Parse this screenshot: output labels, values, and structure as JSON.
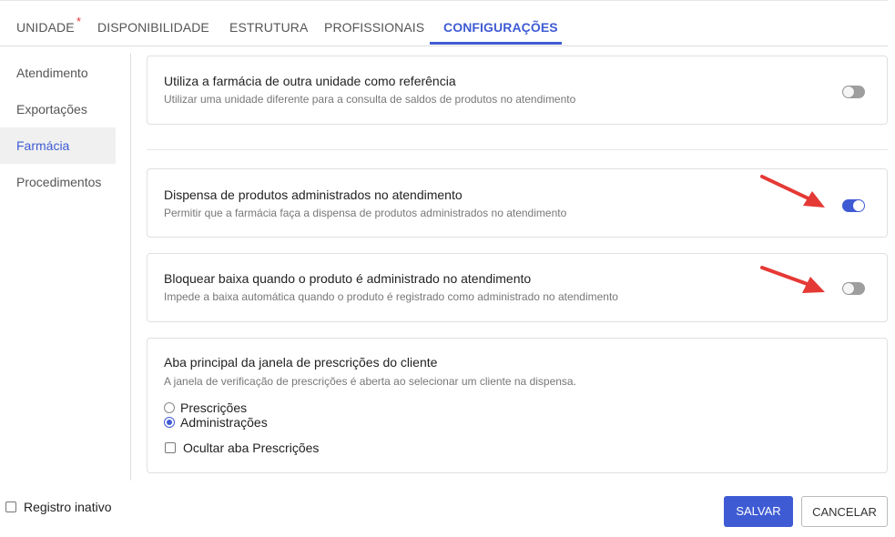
{
  "tabs": [
    {
      "label": "UNIDADE",
      "required_mark": "*"
    },
    {
      "label": "DISPONIBILIDADE"
    },
    {
      "label": "ESTRUTURA"
    },
    {
      "label": "PROFISSIONAIS"
    },
    {
      "label": "CONFIGURAÇÕES",
      "active": true
    }
  ],
  "sidebar": {
    "items": [
      {
        "label": "Atendimento"
      },
      {
        "label": "Exportações"
      },
      {
        "label": "Farmácia",
        "active": true
      },
      {
        "label": "Procedimentos"
      }
    ]
  },
  "settings": [
    {
      "title": "Utiliza a farmácia de outra unidade como referência",
      "description": "Utilizar uma unidade diferente para a consulta de saldos de produtos no atendimento",
      "enabled": false
    },
    {
      "title": "Dispensa de produtos administrados no atendimento",
      "description": "Permitir que a farmácia faça a dispensa de produtos administrados no atendimento",
      "enabled": true
    },
    {
      "title": "Bloquear baixa quando o produto é administrado no atendimento",
      "description": "Impede a baixa automática quando o produto é registrado como administrado no atendimento",
      "enabled": false
    }
  ],
  "prescription_tab": {
    "title": "Aba principal da janela de prescrições do cliente",
    "description": "A janela de verificação de prescrições é aberta ao selecionar um cliente na dispensa.",
    "options": [
      {
        "label": "Prescrições",
        "selected": false
      },
      {
        "label": "Administrações",
        "selected": true
      }
    ],
    "hide_checkbox": {
      "label": "Ocultar aba Prescrições",
      "checked": false
    }
  },
  "footer": {
    "inactive_checkbox": {
      "label": "Registro inativo",
      "checked": false
    },
    "save_label": "SALVAR",
    "cancel_label": "CANCELAR"
  },
  "colors": {
    "accent": "#3f5bd4",
    "annotation_arrow": "#e53935",
    "required_mark": "#e53935"
  }
}
